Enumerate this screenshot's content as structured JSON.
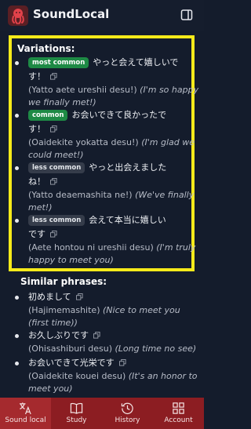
{
  "app": {
    "title": "SoundLocal",
    "accent": "#f6ea1a",
    "nav_bg": "#8c1d22"
  },
  "header": {
    "sidebar_icon": "sidebar-toggle-icon"
  },
  "variations": {
    "title": "Variations:",
    "items": [
      {
        "badge": "most common",
        "jp1": "やっと会えて嬉しいで",
        "jp2": "す！",
        "roman": "(Yatto aete ureshii desu!)",
        "trans1": "(I'm so happy",
        "trans2": "we finally met!)"
      },
      {
        "badge": "common",
        "jp1": "お会いできて良かったで",
        "jp2": "す！",
        "roman": "(Oaidekite yokatta desu!)",
        "trans1": "(I'm glad we",
        "trans2": "could meet!)"
      },
      {
        "badge": "less common",
        "jp1": "やっと出会えました",
        "jp2": "ね！",
        "roman": "(Yatto deaemashita ne!)",
        "trans1": "(We've finally",
        "trans2": "met!)"
      },
      {
        "badge": "less common",
        "jp1": "会えて本当に嬉しい",
        "jp2": "です",
        "roman": "(Aete hontou ni ureshii desu)",
        "trans1": "(I'm truly",
        "trans2": "happy to meet you)"
      }
    ]
  },
  "similar": {
    "title": "Similar phrases:",
    "items": [
      {
        "jp": "初めまして",
        "roman": "(Hajimemashite)",
        "trans1": "(Nice to meet you",
        "trans2": "(first time))"
      },
      {
        "jp": "お久しぶりです",
        "roman": "(Ohisashiburi desu)",
        "trans1": "(Long time no see)",
        "trans2": ""
      },
      {
        "jp": "お会いできて光栄です",
        "roman": "(Oaidekite kouei desu)",
        "trans1": "(It's an honor to",
        "trans2": "meet you)"
      }
    ]
  },
  "nav": [
    {
      "label": "Sound local",
      "icon": "translate-icon",
      "active": true
    },
    {
      "label": "Study",
      "icon": "book-icon",
      "active": false
    },
    {
      "label": "History",
      "icon": "history-icon",
      "active": false
    },
    {
      "label": "Account",
      "icon": "grid-icon",
      "active": false
    }
  ]
}
